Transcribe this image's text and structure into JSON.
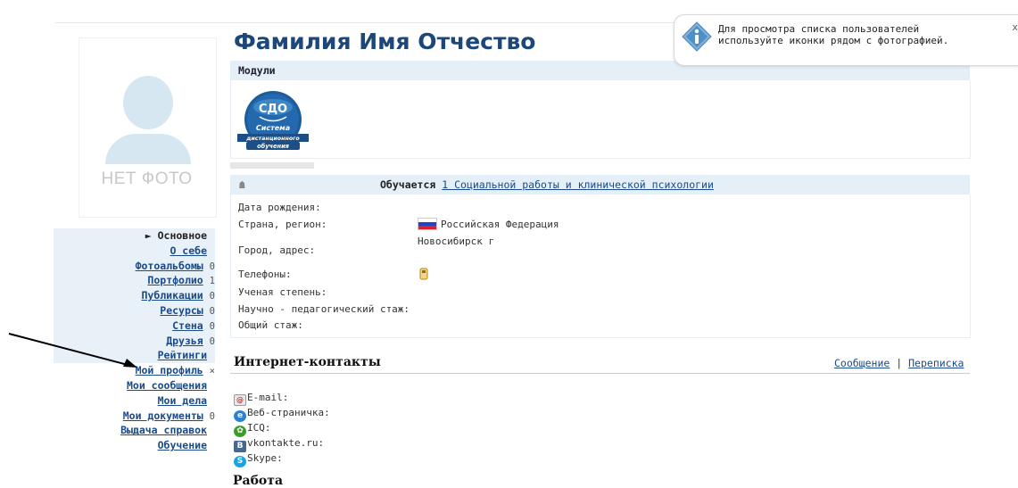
{
  "profile": {
    "name": "Фамилия Имя Отчество",
    "no_photo": "НЕТ ФОТО"
  },
  "nav": [
    {
      "label": "Основное",
      "count": "",
      "active": true
    },
    {
      "label": "О себе",
      "count": ""
    },
    {
      "label": "Фотоальбомы",
      "count": "0"
    },
    {
      "label": "Портфолио",
      "count": "1"
    },
    {
      "label": "Публикации",
      "count": "0"
    },
    {
      "label": "Ресурсы",
      "count": "0"
    },
    {
      "label": "Стена",
      "count": "0"
    },
    {
      "label": "Друзья",
      "count": "0"
    },
    {
      "label": "Рейтинги",
      "count": ""
    },
    {
      "label": "Мой профиль",
      "count": "×"
    },
    {
      "label": "Мои сообщения",
      "count": ""
    },
    {
      "label": "Мои дела",
      "count": ""
    },
    {
      "label": "Мои документы",
      "count": "0"
    },
    {
      "label": "Выдача справок",
      "count": ""
    },
    {
      "label": "Обучение",
      "count": ""
    }
  ],
  "modules": {
    "header": "Модули",
    "sdo_logo": {
      "top": "СДО",
      "line1": "Система",
      "line2": "дистанционного",
      "line3": "обучения"
    }
  },
  "study": {
    "label": "Обучается",
    "link": "1 Социальной работы и клинической психологии"
  },
  "info": {
    "birth_label": "Дата рождения:",
    "country_label": "Страна, регион:",
    "country_value": "Российская Федерация",
    "city_label": "Город, адрес:",
    "city_value": "Новосибирск г",
    "phones_label": "Телефоны:",
    "degree_label": "Ученая степень:",
    "teach_label": "Научно - педагогический стаж:",
    "total_label": "Общий стаж:"
  },
  "contacts": {
    "title": "Интернет-контакты",
    "message_link": "Сообщение",
    "separator": "|",
    "correspondence_link": "Переписка",
    "email": "E-mail:",
    "web": "Веб-страничка:",
    "icq": "ICQ:",
    "vk": "vkontakte.ru:",
    "skype": "Skype:"
  },
  "work": {
    "title": "Работа"
  },
  "tooltip": {
    "text": "Для просмотра списка пользователей используйте иконки рядом с фотографией.",
    "close": "x"
  },
  "colors": {
    "accent": "#1d4778",
    "link": "#1a4a8a",
    "bar": "#e4eff8"
  }
}
